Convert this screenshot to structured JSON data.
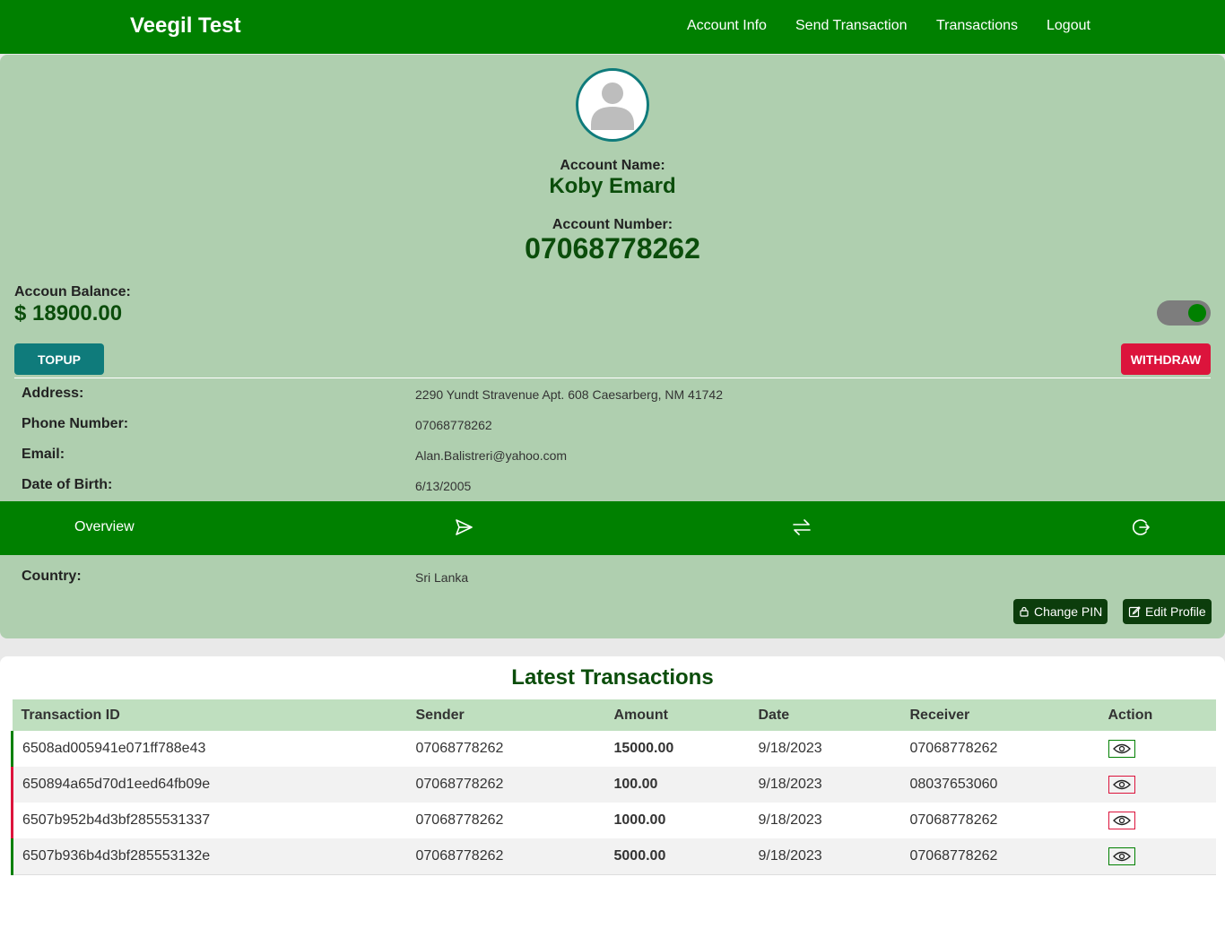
{
  "header": {
    "brand": "Veegil Test",
    "nav": [
      "Account Info",
      "Send Transaction",
      "Transactions",
      "Logout"
    ]
  },
  "account": {
    "name_label": "Account Name:",
    "name": "Koby Emard",
    "number_label": "Account Number:",
    "number": "07068778262",
    "balance_label": "Accoun Balance:",
    "balance": "$ 18900.00",
    "toggle_on": true,
    "topup_label": "TOPUP",
    "withdraw_label": "WITHDRAW",
    "details": [
      {
        "label": "Address:",
        "value": "2290 Yundt Stravenue Apt. 608 Caesarberg, NM 41742"
      },
      {
        "label": "Phone Number:",
        "value": "07068778262"
      },
      {
        "label": "Email:",
        "value": "Alan.Balistreri@yahoo.com"
      },
      {
        "label": "Date of Birth:",
        "value": "6/13/2005"
      },
      {
        "label": "Country:",
        "value": "Sri Lanka"
      }
    ],
    "tabs": {
      "overview": "Overview",
      "icons": [
        "send-icon",
        "transfer-icon",
        "logout-icon"
      ]
    },
    "change_pin_label": "Change PIN",
    "edit_profile_label": "Edit Profile"
  },
  "transactions": {
    "title": "Latest Transactions",
    "columns": [
      "Transaction ID",
      "Sender",
      "Amount",
      "Date",
      "Receiver",
      "Action"
    ],
    "rows": [
      {
        "id": "6508ad005941e071ff788e43",
        "sender": "07068778262",
        "amount": "15000.00",
        "date": "9/18/2023",
        "receiver": "07068778262",
        "type": "credit"
      },
      {
        "id": "650894a65d70d1eed64fb09e",
        "sender": "07068778262",
        "amount": "100.00",
        "date": "9/18/2023",
        "receiver": "08037653060",
        "type": "debit"
      },
      {
        "id": "6507b952b4d3bf2855531337",
        "sender": "07068778262",
        "amount": "1000.00",
        "date": "9/18/2023",
        "receiver": "07068778262",
        "type": "debit"
      },
      {
        "id": "6507b936b4d3bf285553132e",
        "sender": "07068778262",
        "amount": "5000.00",
        "date": "9/18/2023",
        "receiver": "07068778262",
        "type": "credit"
      }
    ]
  },
  "colors": {
    "primary_green": "#008000",
    "card_bg": "#afcfaf",
    "dark_green_text": "#0b4d0b",
    "teal": "#0f7b7b",
    "crimson": "#dc143c"
  }
}
